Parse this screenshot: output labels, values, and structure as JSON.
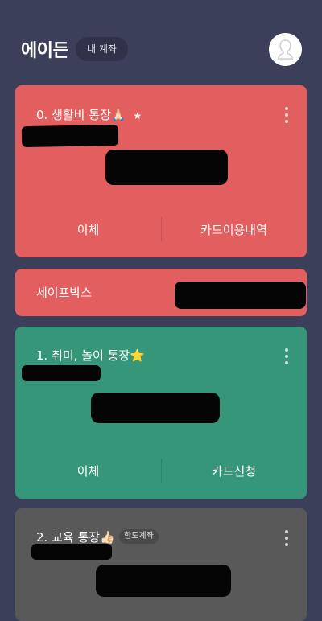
{
  "header": {
    "user_name": "에이든",
    "account_chip": "내 계좌"
  },
  "accounts": [
    {
      "title": "0. 생활비 통장",
      "emoji": "🙏🏻",
      "star": "★",
      "color": "#e35f5f",
      "actions": [
        "이체",
        "카드이용내역"
      ]
    },
    {
      "title": "세이프박스",
      "color": "#e35f5f"
    },
    {
      "title": "1. 취미, 놀이 통장",
      "emoji": "⭐",
      "color": "#36967a",
      "actions": [
        "이체",
        "카드신청"
      ]
    },
    {
      "title": "2. 교육 통장",
      "emoji": "👍🏻",
      "badge": "한도계좌",
      "color": "#595959"
    }
  ],
  "icons": {
    "avatar": "user-avatar-icon",
    "more": "kebab-menu-icon"
  }
}
